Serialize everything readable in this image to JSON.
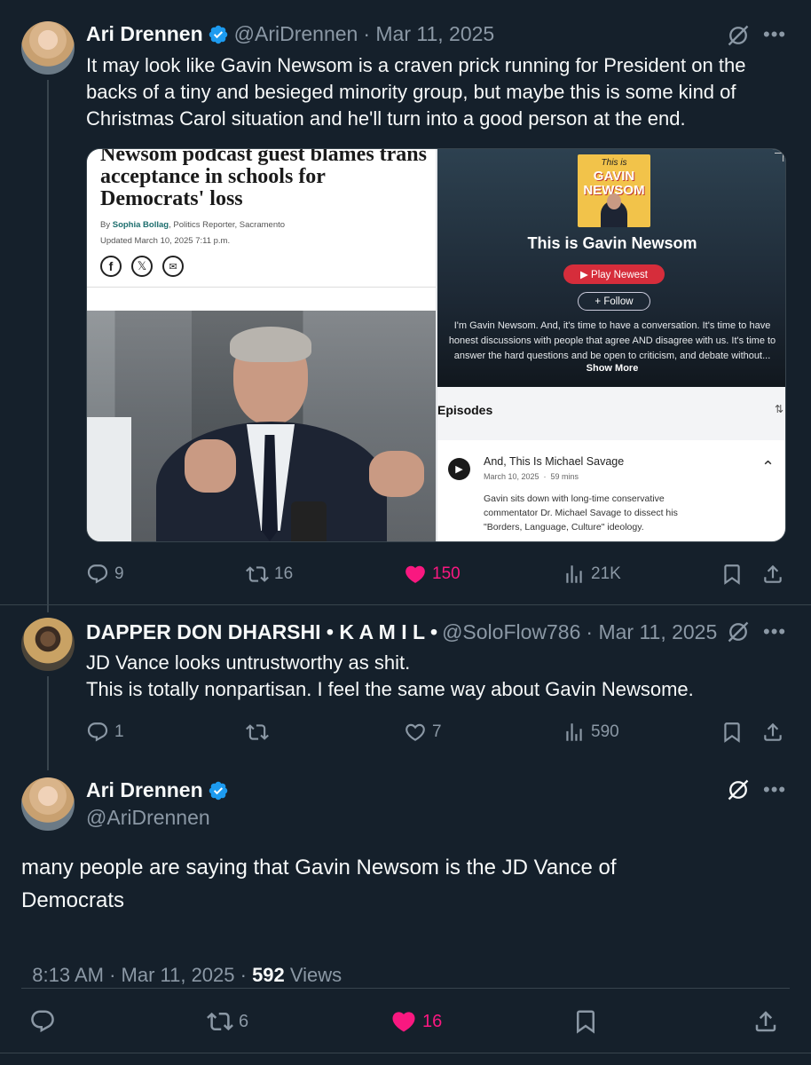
{
  "colors": {
    "background": "#15202b",
    "accent_like": "#f91880",
    "verified": "#1d9bf0",
    "muted": "#8b98a5"
  },
  "tweet1": {
    "name": "Ari Drennen",
    "handle": "@AriDrennen",
    "date": "· Mar 11, 2025",
    "text": "It may look like Gavin Newsom is a craven prick running for President on the backs of a tiny and besieged minority group, but maybe this is some kind of Christmas Carol situation and he'll turn into a good person at the end.",
    "media": {
      "article": {
        "headline": "Newsom podcast guest blames trans acceptance in schools for Democrats' loss",
        "byline_prefix": "By",
        "author": "Sophia Bollag",
        "author_role": ", Politics Reporter, Sacramento",
        "updated": "Updated March 10, 2025 7:11 p.m."
      },
      "podcast": {
        "cover_line1": "This is",
        "cover_line2": "GAVIN",
        "cover_line3": "NEWSOM",
        "title": "This is Gavin Newsom",
        "play_label": "▶  Play Newest",
        "follow_label": "+ Follow",
        "description": "I'm Gavin Newsom. And, it's time to have a conversation. It's time to have honest discussions with people that agree AND disagree with us. It's time to answer the hard questions and be open to criticism, and debate without...",
        "show_more": "Show More",
        "episodes_label": "Episodes",
        "episode_title": "And, This Is Michael Savage",
        "episode_meta": "March 10, 2025  ·  59 mins",
        "episode_desc": "Gavin sits down with long-time conservative commentator Dr. Michael Savage to dissect his \"Borders, Language, Culture\" ideology."
      }
    },
    "stats": {
      "replies": "9",
      "reposts": "16",
      "likes": "150",
      "views": "21K"
    }
  },
  "tweet2": {
    "name": "DAPPER DON DHARSHI • K A M I L •",
    "handle": "@SoloFlow786",
    "date": "· Mar 11, 2025",
    "text_line1": "JD Vance looks untrustworthy as shit.",
    "text_line2": "This is totally nonpartisan. I feel the same way about Gavin Newsome.",
    "stats": {
      "replies": "1",
      "reposts": "",
      "likes": "7",
      "views": "590"
    }
  },
  "tweet3": {
    "name": "Ari Drennen",
    "handle": "@AriDrennen",
    "text": "many people are saying that Gavin Newsom is the JD Vance of Democrats",
    "time": "8:13 AM · Mar 11, 2025 · ",
    "views_count": "592",
    "views_label": " Views",
    "stats": {
      "replies": "",
      "reposts": "6",
      "likes": "16"
    }
  },
  "icons": [
    "grok-icon",
    "more-icon",
    "reply-icon",
    "repost-icon",
    "like-icon",
    "views-icon",
    "bookmark-icon",
    "share-icon",
    "verified-badge-icon"
  ]
}
